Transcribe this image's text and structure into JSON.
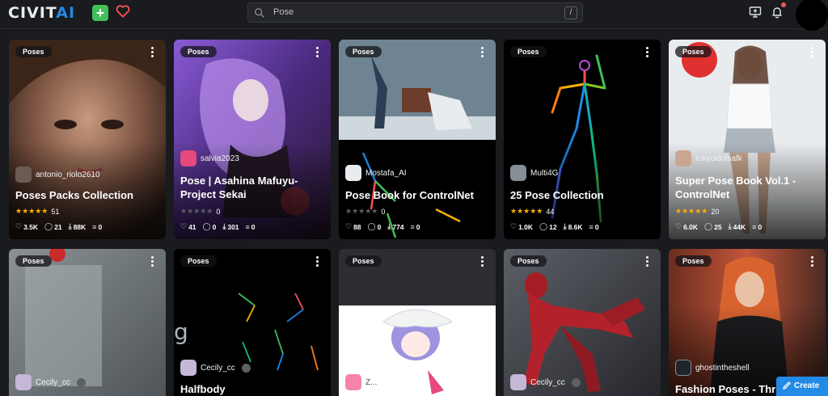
{
  "header": {
    "logo_main": "CIVIT",
    "logo_accent": "AI",
    "search_value": "Pose",
    "search_shortcut": "/",
    "icons": [
      "plus-icon",
      "heart-icon",
      "search-icon",
      "upload-screen-icon",
      "bell-icon"
    ]
  },
  "cards": [
    {
      "badge": "Poses",
      "creator": "antonio_riolo2610",
      "title": "Poses Packs Collection",
      "rating": "51",
      "rated": true,
      "likes": "3.5K",
      "comments": "21",
      "downloads": "88K",
      "tips": "0"
    },
    {
      "badge": "Poses",
      "creator": "salvia2023",
      "title": "Pose | Asahina Mafuyu- Project Sekai",
      "rating": "0",
      "rated": false,
      "likes": "41",
      "comments": "0",
      "downloads": "301",
      "tips": "0"
    },
    {
      "badge": "Poses",
      "creator": "Mostafa_AI",
      "title": "Pose Book for ControlNet",
      "rating": "0",
      "rated": false,
      "likes": "88",
      "comments": "0",
      "downloads": "774",
      "tips": "0"
    },
    {
      "badge": "Poses",
      "creator": "Multi4G",
      "title": "25 Pose Collection",
      "rating": "44",
      "rated": true,
      "likes": "1.0K",
      "comments": "12",
      "downloads": "8.6K",
      "tips": "0"
    },
    {
      "badge": "Poses",
      "creator": "tokyoidolsafk",
      "title": "Super Pose Book Vol.1 - ControlNet",
      "rating": "20",
      "rated": true,
      "likes": "6.0K",
      "comments": "25",
      "downloads": "44K",
      "tips": "0"
    },
    {
      "badge": "Poses",
      "creator": "Cecily_cc",
      "title": ""
    },
    {
      "badge": "Poses",
      "creator": "Cecily_cc",
      "title": "Halfbody"
    },
    {
      "badge": "Poses",
      "creator": "Z...",
      "title": ""
    },
    {
      "badge": "Poses",
      "creator": "Cecily_cc",
      "title": ""
    },
    {
      "badge": "Poses",
      "creator": "ghostintheshell",
      "title": "Fashion Poses - Thre"
    }
  ],
  "create_button": "Create",
  "colors": {
    "background": "#1a1b1e",
    "accent": "#228be6",
    "star": "#fab005",
    "plus": "#40c057"
  }
}
